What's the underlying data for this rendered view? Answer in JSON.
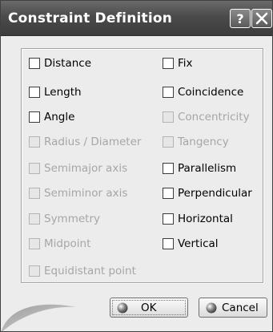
{
  "dialog": {
    "title": "Constraint Definition",
    "help_icon": "question-mark-icon",
    "close_icon": "close-icon"
  },
  "constraints": {
    "left": [
      {
        "label": "Distance",
        "enabled": true,
        "checked": false
      },
      {
        "label": "Length",
        "enabled": true,
        "checked": false
      },
      {
        "label": "Angle",
        "enabled": true,
        "checked": false
      },
      {
        "label": "Radius / Diameter",
        "enabled": false,
        "checked": false
      },
      {
        "label": "Semimajor axis",
        "enabled": false,
        "checked": false
      },
      {
        "label": "Semiminor axis",
        "enabled": false,
        "checked": false
      },
      {
        "label": "Symmetry",
        "enabled": false,
        "checked": false
      },
      {
        "label": "Midpoint",
        "enabled": false,
        "checked": false
      },
      {
        "label": "Equidistant point",
        "enabled": false,
        "checked": false
      }
    ],
    "right": [
      {
        "label": "Fix",
        "enabled": true,
        "checked": false
      },
      {
        "label": "Coincidence",
        "enabled": true,
        "checked": false
      },
      {
        "label": "Concentricity",
        "enabled": false,
        "checked": false
      },
      {
        "label": "Tangency",
        "enabled": false,
        "checked": false
      },
      {
        "label": "Parallelism",
        "enabled": true,
        "checked": false
      },
      {
        "label": "Perpendicular",
        "enabled": true,
        "checked": false
      },
      {
        "label": "Horizontal",
        "enabled": true,
        "checked": false
      },
      {
        "label": "Vertical",
        "enabled": true,
        "checked": false
      }
    ]
  },
  "buttons": {
    "ok_label": "OK",
    "cancel_label": "Cancel"
  },
  "colors": {
    "titlebar": "#4b4b4b",
    "dialog_bg": "#ececec",
    "disabled_text": "#a6a6a6"
  }
}
